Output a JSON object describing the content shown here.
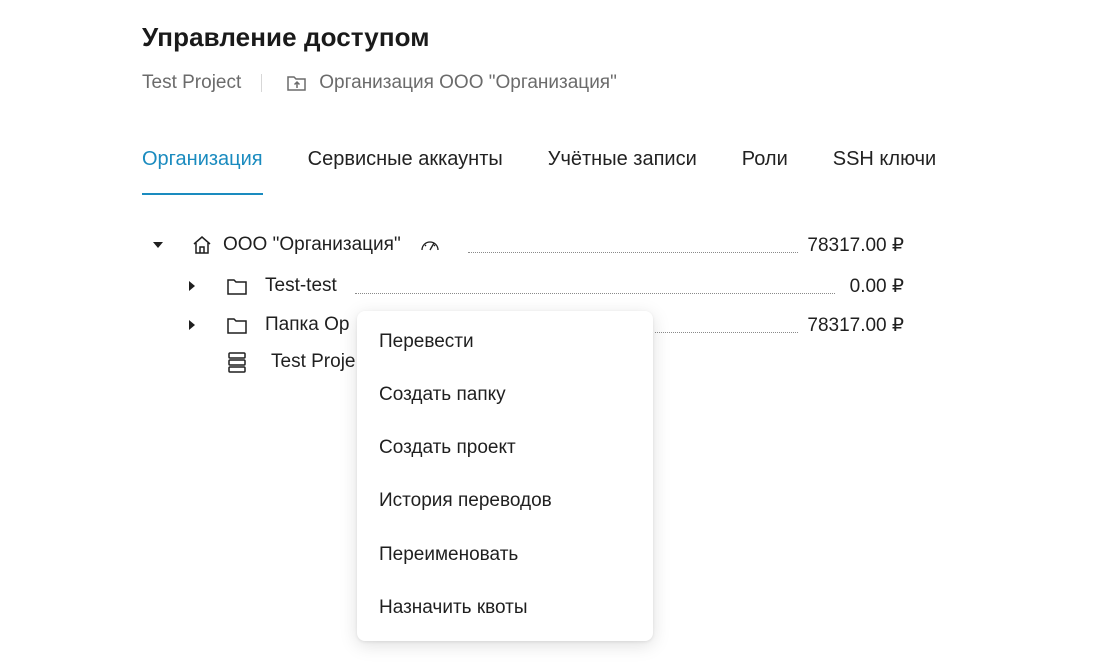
{
  "header": {
    "title": "Управление доступом",
    "breadcrumb": {
      "project": "Test Project",
      "organization": "Организация ООО \"Организация\""
    }
  },
  "tabs": [
    {
      "label": "Организация",
      "active": true
    },
    {
      "label": "Сервисные аккаунты",
      "active": false
    },
    {
      "label": "Учётные записи",
      "active": false
    },
    {
      "label": "Роли",
      "active": false
    },
    {
      "label": "SSH ключи",
      "active": false
    }
  ],
  "tree": {
    "root": {
      "name": "ООО \"Организация\"",
      "amount": "78317.00 ₽",
      "expanded": true
    },
    "children": [
      {
        "name": "Test-test",
        "amount": "0.00 ₽",
        "type": "folder",
        "expanded": false
      },
      {
        "name": "Папка Ор",
        "amount": "78317.00 ₽",
        "type": "folder",
        "expanded": false
      },
      {
        "name": "Test Proje",
        "type": "project"
      }
    ]
  },
  "context_menu": {
    "items": [
      "Перевести",
      "Создать папку",
      "Создать проект",
      "История переводов",
      "Переименовать",
      "Назначить квоты"
    ]
  },
  "colors": {
    "accent": "#1a8bbf",
    "text": "#1f1f1f",
    "muted": "#6b6b6b"
  }
}
